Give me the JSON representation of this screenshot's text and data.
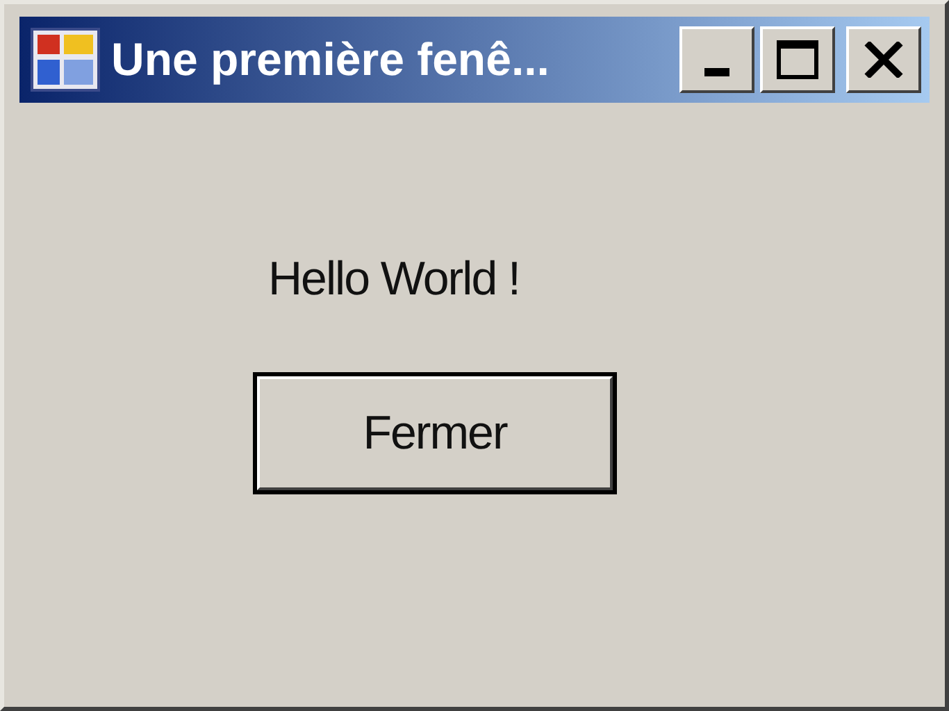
{
  "window": {
    "title": "Une première fenê..."
  },
  "label": "Hello World !",
  "buttons": [
    {
      "label": "Fermer",
      "default": true
    }
  ]
}
